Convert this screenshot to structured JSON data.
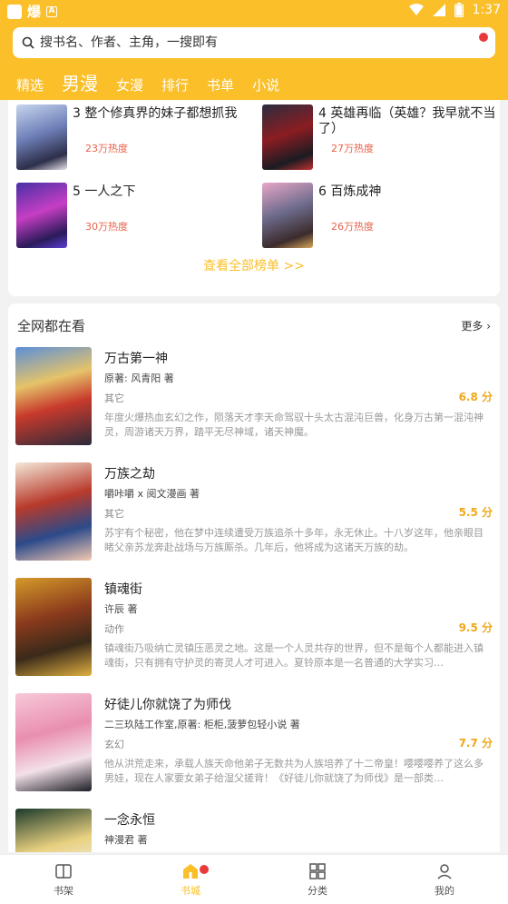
{
  "status": {
    "time": "1:37",
    "battery": "1"
  },
  "search": {
    "placeholder": "搜书名、作者、主角，一搜即有"
  },
  "tabs": [
    "精选",
    "男漫",
    "女漫",
    "排行",
    "书单",
    "小说"
  ],
  "rank_list": [
    {
      "rank": "3",
      "title": "整个修真界的妹子都想抓我",
      "heat": "23万热度"
    },
    {
      "rank": "4",
      "title": "英雄再临（英雄？我早就不当了）",
      "heat": "27万热度"
    },
    {
      "rank": "5",
      "title": "一人之下",
      "heat": "30万热度"
    },
    {
      "rank": "6",
      "title": "百炼成神",
      "heat": "26万热度"
    }
  ],
  "view_all": "查看全部榜单 >>",
  "section": {
    "title": "全网都在看",
    "more": "更多"
  },
  "books": [
    {
      "title": "万古第一神",
      "author": "原著: 风青阳 著",
      "genre": "其它",
      "score": "6.8 分",
      "desc": "年度火爆热血玄幻之作，陨落天才李天命驾驭十头太古混沌巨兽，化身万古第一混沌神灵，周游诸天万界，踏平无尽神域，诸天神魔。"
    },
    {
      "title": "万族之劫",
      "author": "嚼咔嚼 x 阅文漫画 著",
      "genre": "其它",
      "score": "5.5 分",
      "desc": "苏宇有个秘密，他在梦中连续遭受万族追杀十多年，永无休止。十八岁这年，他亲眼目睹父亲苏龙奔赴战场与万族厮杀。几年后，他将成为这诸天万族的劫。"
    },
    {
      "title": "镇魂街",
      "author": "许辰 著",
      "genre": "动作",
      "score": "9.5 分",
      "desc": "镇魂街乃吸纳亡灵镇压恶灵之地。这是一个人灵共存的世界，但不是每个人都能进入镇魂街，只有拥有守护灵的寄灵人才可进入。夏铃原本是一名普通的大学实习…"
    },
    {
      "title": "好徒儿你就饶了为师伐",
      "author": "二三玖陆工作室,原著: 柜柜,菠萝包轻小说 著",
      "genre": "玄幻",
      "score": "7.7 分",
      "desc": "他从洪荒走来，承载人族天命他弟子无数共为人族培养了十二帝皇！嘤嘤嘤养了这么多男娃，现在人家要女弟子给湿父搓背！《好徒儿你就饶了为师伐》是一部类…"
    },
    {
      "title": "一念永恒",
      "author": "神漫君 著",
      "genre": "",
      "score": "",
      "desc": ""
    }
  ],
  "nav": [
    {
      "label": "书架",
      "icon": "bookshelf-icon"
    },
    {
      "label": "书城",
      "icon": "bookstore-icon"
    },
    {
      "label": "分类",
      "icon": "category-icon"
    },
    {
      "label": "我的",
      "icon": "profile-icon"
    }
  ],
  "colors": {
    "accent": "#fbbf2a",
    "heat": "#e8624a",
    "badge": "#e83a3a"
  }
}
